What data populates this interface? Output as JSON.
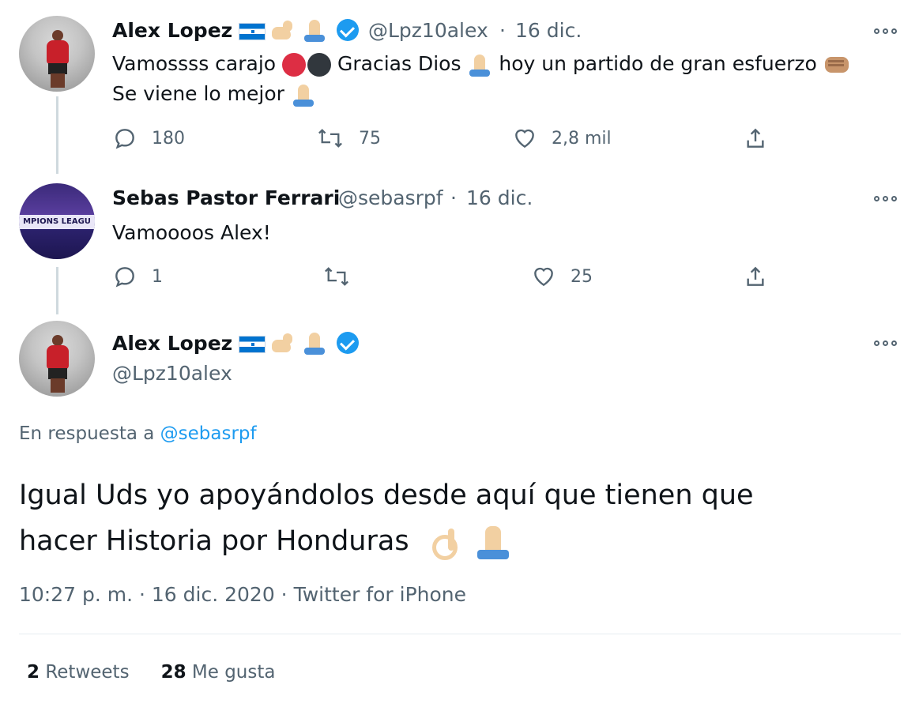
{
  "tweet1": {
    "name": "Alex Lopez",
    "handle": "@Lpz10alex",
    "separator": "·",
    "date": "16 dic.",
    "text_part1": "Vamossss carajo",
    "text_part2": "Gracias Dios",
    "text_part3": "hoy un partido de gran esfuerzo",
    "text_line2": "Se viene lo mejor",
    "replies": "180",
    "retweets": "75",
    "likes": "2,8 mil"
  },
  "tweet2": {
    "name": "Sebas Pastor Ferrari",
    "handle": "@sebasrpf",
    "separator": "·",
    "date": "16 dic.",
    "text": "Vamoooos Alex!",
    "avatar_text": "MPIONS LEAGU",
    "replies": "1",
    "likes": "25"
  },
  "tweet3": {
    "name": "Alex Lopez",
    "handle": "@Lpz10alex",
    "reply_prefix": "En respuesta a",
    "reply_mention": "@sebasrpf",
    "text_line1": "Igual Uds yo apoyándolos desde aquí que tienen que",
    "text_line2": "hacer Historia por Honduras",
    "meta": "10:27 p. m. · 16 dic. 2020 · Twitter for iPhone",
    "retweets_count": "2",
    "retweets_label": "Retweets",
    "likes_count": "28",
    "likes_label": "Me gusta"
  },
  "colors": {
    "accent": "#1d9bf0",
    "secondary_text": "#536471",
    "primary_text": "#0f1419",
    "thread_line": "#cfd9de"
  },
  "icons": [
    "honduras-flag-icon",
    "flexed-biceps-icon",
    "folded-hands-icon",
    "verified-badge-icon",
    "red-circle-icon",
    "black-circle-icon",
    "fist-icon",
    "ok-hand-icon",
    "reply-icon",
    "retweet-icon",
    "like-icon",
    "share-icon",
    "more-icon"
  ]
}
